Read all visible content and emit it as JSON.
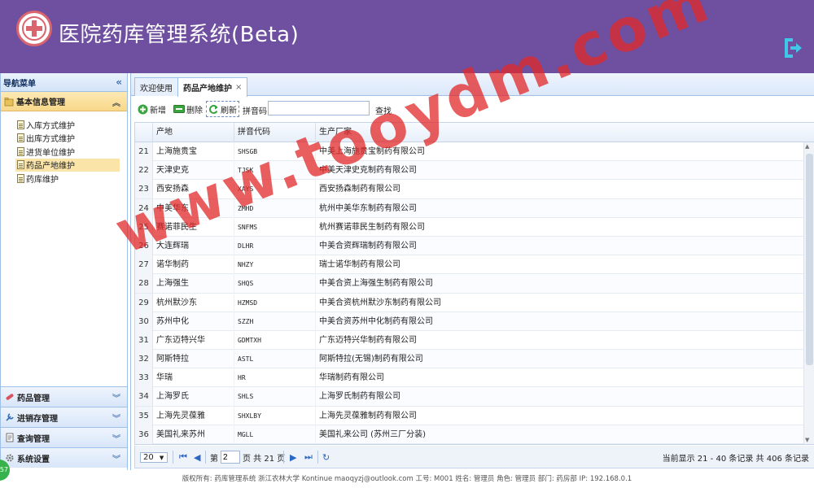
{
  "header": {
    "title": "医院药库管理系统(Beta)",
    "logout_icon": "logout-icon"
  },
  "sidebar": {
    "nav_title": "导航菜单",
    "section_title": "基本信息管理",
    "items": [
      {
        "label": "入库方式维护"
      },
      {
        "label": "出库方式维护"
      },
      {
        "label": "进货单位维护"
      },
      {
        "label": "药品产地维护"
      },
      {
        "label": "药库维护"
      }
    ],
    "accordions": [
      {
        "label": "药品管理"
      },
      {
        "label": "进销存管理"
      },
      {
        "label": "查询管理"
      },
      {
        "label": "系统设置"
      }
    ]
  },
  "tabs": [
    {
      "label": "欢迎使用"
    },
    {
      "label": "药品产地维护"
    }
  ],
  "toolbar": {
    "add_label": "新增",
    "delete_label": "删除",
    "refresh_label": "刷新",
    "pinyin_label": "拼音码",
    "pinyin_value": "",
    "search_label": "查找"
  },
  "grid": {
    "columns": [
      "产地",
      "拼音代码",
      "生产厂家"
    ],
    "rows": [
      {
        "n": "21",
        "origin": "上海施贵宝",
        "code": "SHSGB",
        "maker": "中美上海施贵宝制药有限公司"
      },
      {
        "n": "22",
        "origin": "天津史克",
        "code": "TJSK",
        "maker": "中美天津史克制药有限公司"
      },
      {
        "n": "23",
        "origin": "西安扬森",
        "code": "XAYS",
        "maker": "西安扬森制药有限公司"
      },
      {
        "n": "24",
        "origin": "中美华东",
        "code": "ZMHD",
        "maker": "杭州中美华东制药有限公司"
      },
      {
        "n": "25",
        "origin": "赛诺菲民生",
        "code": "SNFMS",
        "maker": "杭州赛诺菲民生制药有限公司"
      },
      {
        "n": "26",
        "origin": "大连辉瑞",
        "code": "DLHR",
        "maker": "中美合资辉瑞制药有限公司"
      },
      {
        "n": "27",
        "origin": "诺华制药",
        "code": "NHZY",
        "maker": "瑞士诺华制药有限公司"
      },
      {
        "n": "28",
        "origin": "上海强生",
        "code": "SHQS",
        "maker": "中美合资上海强生制药有限公司"
      },
      {
        "n": "29",
        "origin": "杭州默沙东",
        "code": "HZMSD",
        "maker": "中美合资杭州默沙东制药有限公司"
      },
      {
        "n": "30",
        "origin": "苏州中化",
        "code": "SZZH",
        "maker": "中美合资苏州中化制药有限公司"
      },
      {
        "n": "31",
        "origin": "广东迈特兴华",
        "code": "GDMTXH",
        "maker": "广东迈特兴华制药有限公司"
      },
      {
        "n": "32",
        "origin": "阿斯特拉",
        "code": "ASTL",
        "maker": "阿斯特拉(无锡)制药有限公司"
      },
      {
        "n": "33",
        "origin": "华瑞",
        "code": "HR",
        "maker": "华瑞制药有限公司"
      },
      {
        "n": "34",
        "origin": "上海罗氏",
        "code": "SHLS",
        "maker": "上海罗氏制药有限公司"
      },
      {
        "n": "35",
        "origin": "上海先灵葆雅",
        "code": "SHXLBY",
        "maker": "上海先灵葆雅制药有限公司"
      },
      {
        "n": "36",
        "origin": "美国礼来苏州",
        "code": "MGLL",
        "maker": "美国礼来公司 (苏州三厂分装)"
      }
    ]
  },
  "pager": {
    "page_size": "20",
    "page_prefix": "第",
    "page_value": "2",
    "page_suffix": "页 共 21 页",
    "summary": "当前显示 21 - 40 条记录 共 406 条记录"
  },
  "footer": {
    "text": "版权所有: 药库管理系统 浙江农林大学 Kontinue maoqyzj@outlook.com 工号: M001 姓名: 管理员 角色: 管理员 部门: 药房部 IP: 192.168.0.1"
  },
  "badge": {
    "text": "57"
  },
  "watermark": {
    "text": "www.tooydm.com"
  },
  "colors": {
    "header_bg": "#6f4fa0",
    "accent": "#d9656f",
    "panel_border": "#9fc0e6",
    "watermark": "#e12828"
  }
}
